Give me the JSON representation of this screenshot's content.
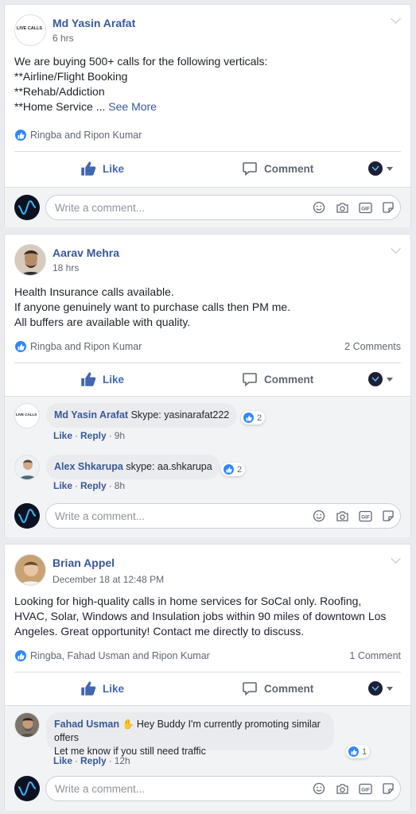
{
  "posts": [
    {
      "avatar_text": "LIVE CALLS",
      "author": "Md Yasin Arafat",
      "time": "6 hrs",
      "lines": [
        "We are buying 500+ calls for the following verticals:",
        "**Airline/Flight Booking",
        "**Rehab/Addiction",
        "**Home Service ... "
      ],
      "see_more": "See More",
      "reactions": "Ringba and Ripon Kumar",
      "comments_count": "",
      "like_label": "Like",
      "comment_label": "Comment",
      "write_placeholder": "Write a comment..."
    },
    {
      "author": "Aarav Mehra",
      "time": "18 hrs",
      "lines": [
        "Health Insurance calls available.",
        "If anyone genuinely want to purchase calls then PM me.",
        "All buffers are available with quality."
      ],
      "reactions": "Ringba and Ripon Kumar",
      "comments_count": "2 Comments",
      "like_label": "Like",
      "comment_label": "Comment",
      "comments": [
        {
          "avatar_text": "LIVE CALLS",
          "name": "Md Yasin Arafat",
          "text": " Skype: yasinarafat222",
          "likes": "2",
          "like": "Like",
          "reply": "Reply",
          "time": "9h"
        },
        {
          "name": "Alex Shkarupa",
          "text": " skype: aa.shkarupa",
          "likes": "2",
          "like": "Like",
          "reply": "Reply",
          "time": "8h"
        }
      ],
      "write_placeholder": "Write a comment..."
    },
    {
      "author": "Brian Appel",
      "time": "December 18 at 12:48 PM",
      "lines": [
        "Looking for high-quality calls in home services for SoCal only. Roofing,",
        "HVAC, Solar, Windows and Insulation jobs within 90 miles of downtown Los",
        "Angeles. Great opportunity! Contact me directly to discuss."
      ],
      "reactions": "Ringba, Fahad Usman and Ripon Kumar",
      "comments_count": "1 Comment",
      "like_label": "Like",
      "comment_label": "Comment",
      "comments": [
        {
          "name": "Fahad Usman",
          "text": " Hey Buddy I'm currently promoting similar offers",
          "text2": "Let me know if you still need traffic",
          "likes": "1",
          "like": "Like",
          "reply": "Reply",
          "time": "12h"
        }
      ],
      "write_placeholder": "Write a comment..."
    }
  ],
  "colors": {
    "link": "#385898",
    "like_blue": "#4267b2",
    "badge_blue": "#2d88ff",
    "page_bg": "#e9ebee"
  }
}
